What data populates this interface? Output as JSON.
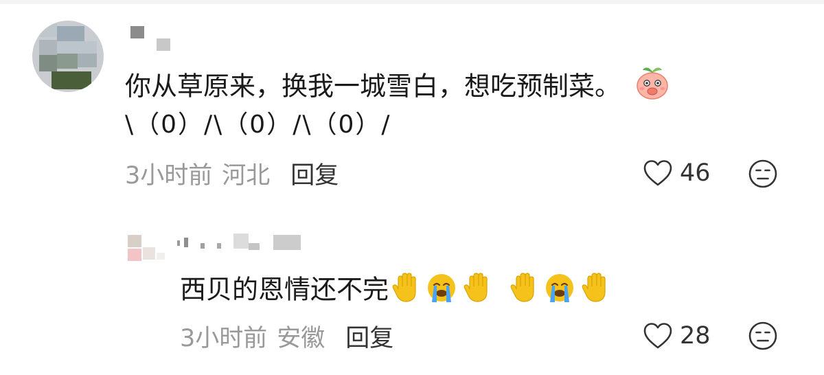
{
  "comments": [
    {
      "text": "你从草原来，换我一城雪白，想吃预制菜。",
      "emoticon_line": "\\（0）/\\（0）/\\（0）/",
      "time": "3小时前",
      "location": "河北",
      "reply_label": "回复",
      "likes": "46",
      "sticker": "peach-covering-mouth-sticker"
    },
    {
      "text": "西贝的恩情还不完",
      "emojis": [
        "raised-hand",
        "loudly-crying-face",
        "raised-hand",
        "raised-hand",
        "loudly-crying-face",
        "raised-hand"
      ],
      "time": "3小时前",
      "location": "安徽",
      "reply_label": "回复",
      "likes": "28"
    }
  ],
  "colors": {
    "meta_gray": "#999999",
    "text": "#1a1a1a",
    "emoji_yellow": "#f5c21b",
    "tear_blue": "#4aa3f0"
  }
}
